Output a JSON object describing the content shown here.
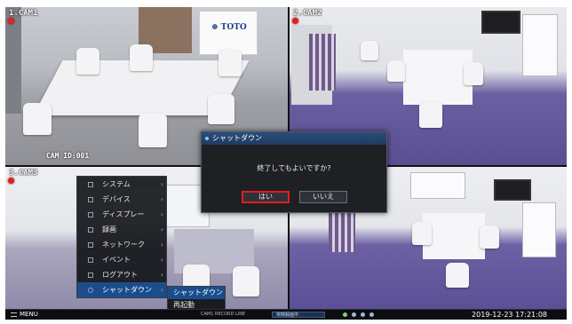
{
  "cameras": [
    {
      "label": "1.CAM1",
      "id_text": "CAM ID:001"
    },
    {
      "label": "2.CAM2"
    },
    {
      "label": "3.CAM3"
    },
    {
      "label": ""
    }
  ],
  "banner_text": "⊕ TOTO",
  "dialog": {
    "title": "シャットダウン",
    "message": "終了してもよいですか?",
    "yes_label": "はい",
    "no_label": "いいえ"
  },
  "menu": {
    "items": [
      {
        "label": "システム",
        "has_arrow": true
      },
      {
        "label": "デバイス",
        "has_arrow": true
      },
      {
        "label": "ディスプレー",
        "has_arrow": true
      },
      {
        "label": "録画",
        "has_arrow": true
      },
      {
        "label": "ネットワーク",
        "has_arrow": true
      },
      {
        "label": "イベント",
        "has_arrow": true
      },
      {
        "label": "ログアウト",
        "has_arrow": true
      },
      {
        "label": "シャットダウン",
        "has_arrow": true,
        "active": true
      }
    ],
    "arrow": "›"
  },
  "submenu": {
    "items": [
      {
        "label": "シャットダウン",
        "active": true
      },
      {
        "label": "再起動"
      }
    ]
  },
  "bottombar": {
    "menu_label": "MENU",
    "status_text_1": "CAM1 RECORD LINE",
    "status_text_2": "常時録画中",
    "datetime": "2019-12-23 17:21:08"
  },
  "colors": {
    "highlight": "#e21d1d",
    "accent": "#1b4d8c"
  }
}
